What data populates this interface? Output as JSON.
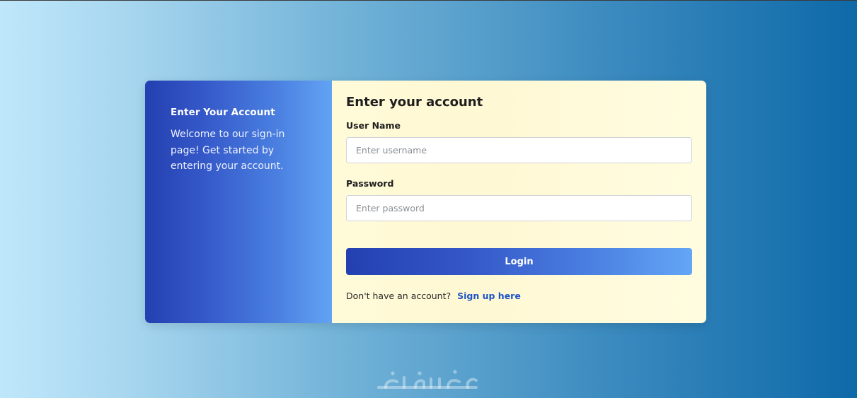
{
  "info_panel": {
    "title": "Enter Your Account",
    "description": "Welcome to our sign-in page! Get started by entering your account."
  },
  "login_form": {
    "title": "Enter your account",
    "username": {
      "label": "User Name",
      "placeholder": "Enter username",
      "value": ""
    },
    "password": {
      "label": "Password",
      "placeholder": "Enter password",
      "value": ""
    },
    "submit_label": "Login",
    "signup_prompt": "Don't have an account?",
    "signup_link": "Sign up here"
  },
  "watermark": {
    "text": "خمسات"
  },
  "colors": {
    "accent_start": "#2440b0",
    "accent_end": "#62a3f4",
    "form_background": "#fffad8",
    "link": "#1d55c4"
  }
}
